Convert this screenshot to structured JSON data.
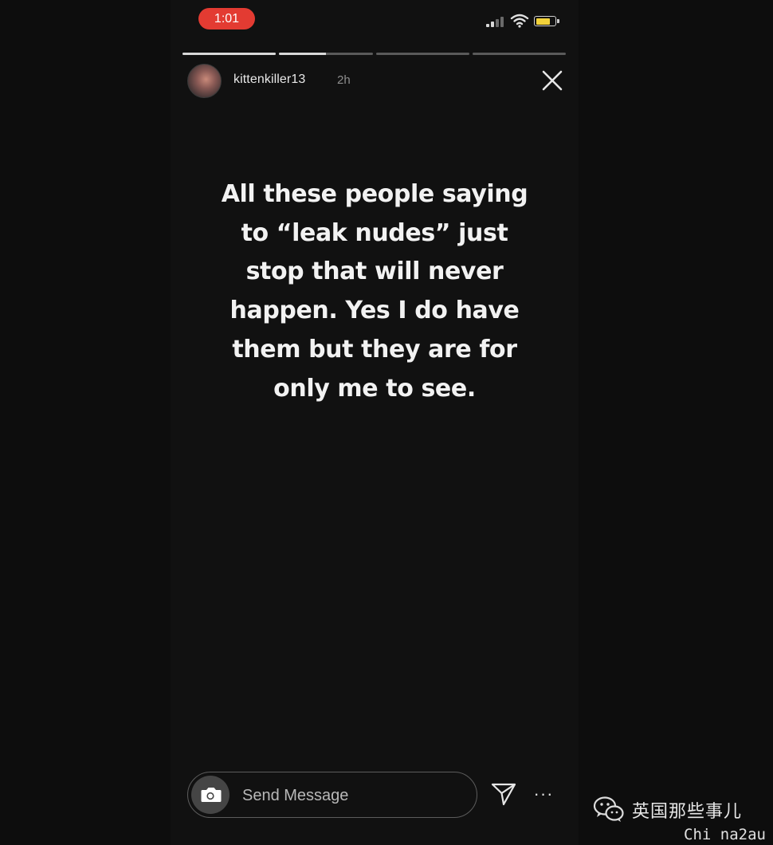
{
  "status_bar": {
    "time": "1:01",
    "time_pill_color": "#e33b32",
    "icons": [
      "signal-icon",
      "wifi-icon",
      "battery-icon"
    ],
    "battery_color": "#f2d23a",
    "battery_level": 0.8
  },
  "story_progress": [
    {
      "segment": 1,
      "progress": 1.0
    },
    {
      "segment": 2,
      "progress": 0.5
    },
    {
      "segment": 3,
      "progress": 0.0
    },
    {
      "segment": 4,
      "progress": 0.0
    }
  ],
  "header": {
    "username": "kittenkiller13",
    "time_ago": "2h",
    "close_icon": "close-icon"
  },
  "story": {
    "lines": [
      "All these people saying",
      "to “leak nudes” just",
      "stop that will never",
      "happen. Yes I do have",
      "them but they are for",
      "only me to see."
    ],
    "text_color": "#f2f2f2",
    "background_color": "#111111"
  },
  "footer": {
    "camera_icon": "camera-icon",
    "message_placeholder": "Send Message",
    "send_icon": "direct-send-icon",
    "more_label": "···"
  },
  "watermark": {
    "logo_icon": "wechat-logo-icon",
    "chinese_text": "英国那些事儿",
    "english_text": "Chi na2au"
  }
}
